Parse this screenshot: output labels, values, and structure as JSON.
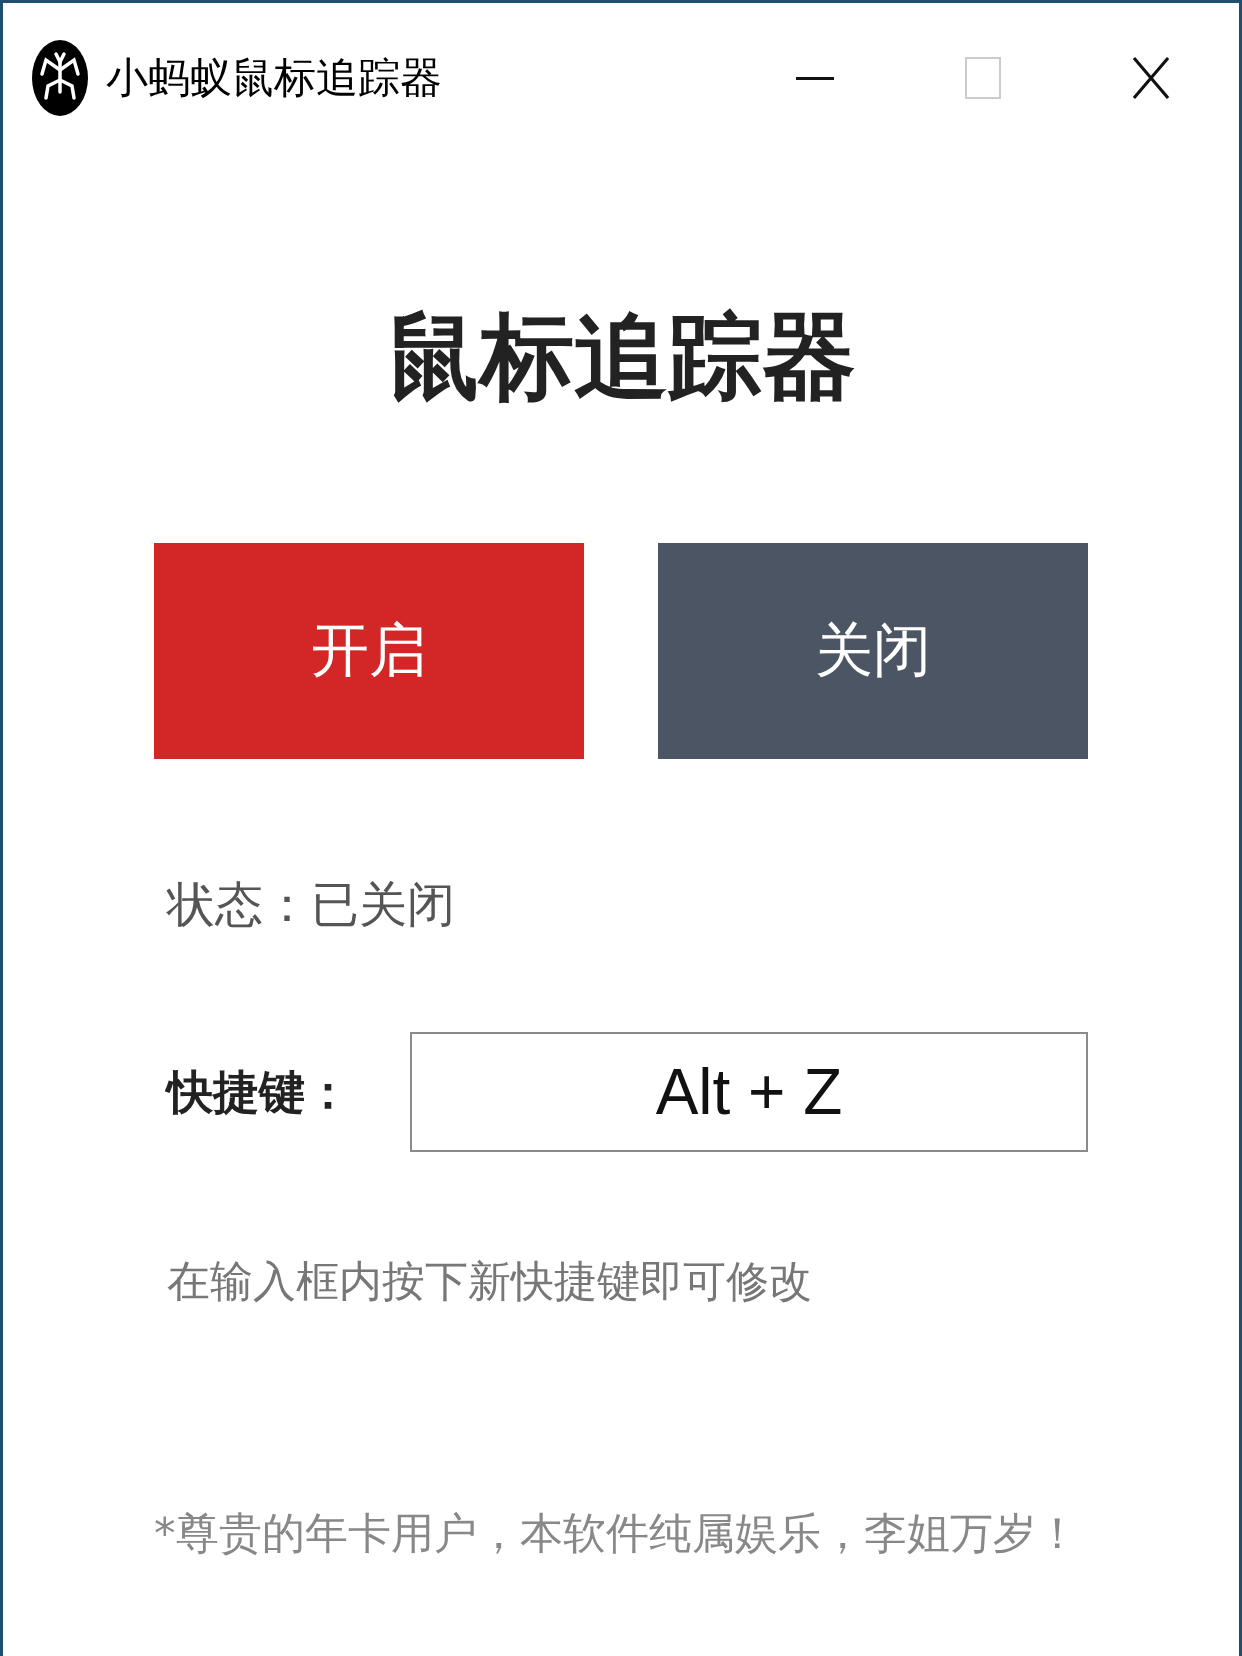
{
  "window": {
    "title": "小蚂蚁鼠标追踪器",
    "controls": [
      {
        "kind": "minimize",
        "disabled": false
      },
      {
        "kind": "maximize",
        "disabled": true
      },
      {
        "kind": "close",
        "disabled": false
      }
    ]
  },
  "heading": "鼠标追踪器",
  "buttons": [
    {
      "label": "开启",
      "color": "#d32626"
    },
    {
      "label": "关闭",
      "color": "#4b5563"
    }
  ],
  "status": "状态：已关闭",
  "shortcut": {
    "label": "快捷键：",
    "value": "Alt + Z"
  },
  "hint": "在输入框内按下新快捷键即可修改",
  "footer": "*尊贵的年卡用户，本软件纯属娱乐，李姐万岁！"
}
